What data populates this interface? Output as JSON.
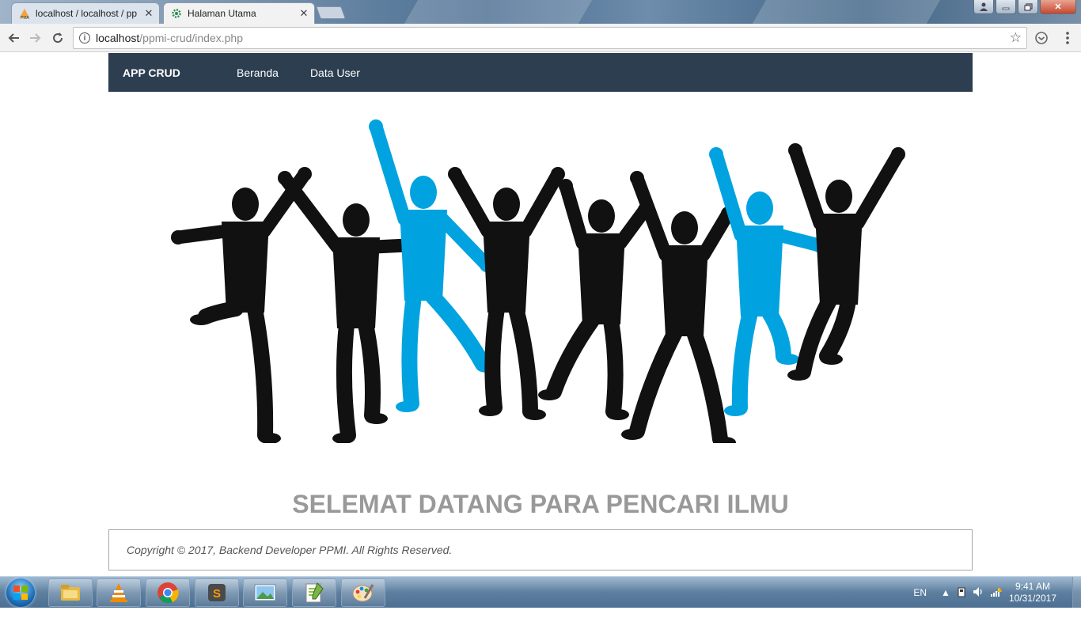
{
  "browser": {
    "tabs": [
      {
        "title": "localhost / localhost / pp",
        "favicon": "phpmyadmin-icon",
        "active": false
      },
      {
        "title": "Halaman Utama",
        "favicon": "gear-icon",
        "active": true
      }
    ],
    "url_host": "localhost",
    "url_path": "/ppmi-crud/index.php"
  },
  "navbar": {
    "brand": "APP CRUD",
    "links": [
      "Beranda",
      "Data User"
    ],
    "background": "#2c3e50"
  },
  "hero": {
    "image": "jumping-people-silhouettes",
    "colors": {
      "black": "#111111",
      "blue": "#00a3e0"
    }
  },
  "welcome_text": "SELEMAT DATANG PARA PENCARI ILMU",
  "footer": {
    "copyright": "Copyright © 2017, Backend Developer PPMI. All Rights Reserved."
  },
  "taskbar": {
    "apps": [
      "file-explorer-icon",
      "vlc-icon",
      "chrome-icon",
      "sublime-text-icon",
      "photo-viewer-icon",
      "notepad-plus-icon",
      "paint-icon"
    ],
    "language": "EN",
    "time": "9:41 AM",
    "date": "10/31/2017"
  }
}
